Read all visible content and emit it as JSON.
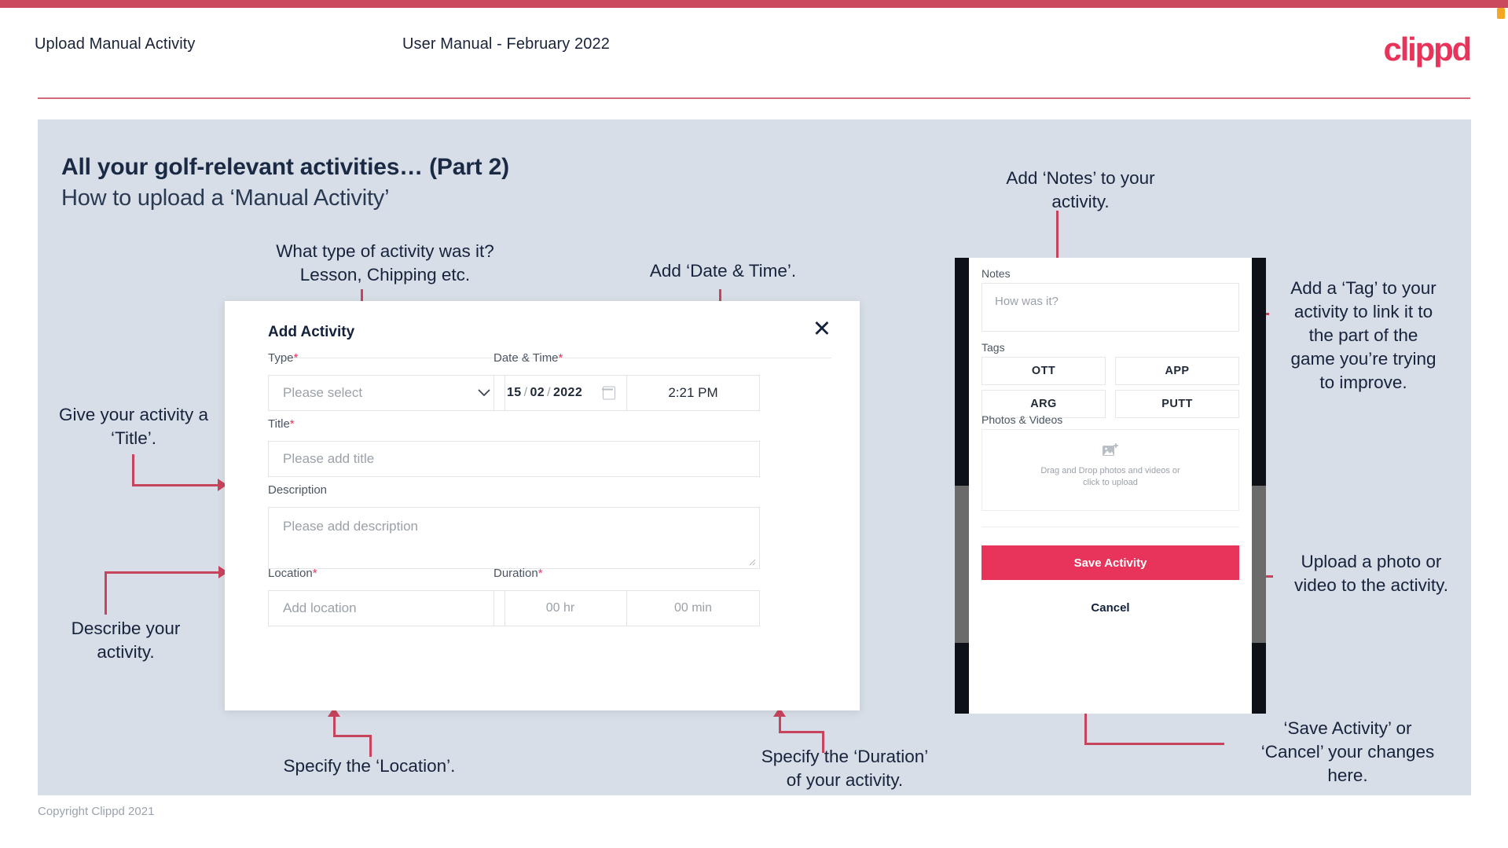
{
  "brand": {
    "accent": "#e8335a",
    "bar": "#cc4a5e",
    "panel_bg": "#d7dee7",
    "logo_text": "clippd"
  },
  "header": {
    "left_title": "Upload Manual Activity",
    "center_title": "User Manual - February 2022"
  },
  "slide": {
    "heading": "All your golf-relevant activities… (Part 2)",
    "subheading": "How to upload a ‘Manual Activity’"
  },
  "footer": {
    "copyright": "Copyright Clippd 2021"
  },
  "dialog": {
    "title": "Add Activity",
    "close_icon": "close-icon",
    "fields": {
      "type": {
        "label": "Type",
        "required": "*",
        "placeholder": "Please select",
        "chevron": "chevron-down-icon"
      },
      "datetime": {
        "label": "Date & Time",
        "required": "*",
        "day": "15",
        "month": "02",
        "year": "2022",
        "sep": "/",
        "calendar_icon": "calendar-icon",
        "time": "2:21 PM"
      },
      "title": {
        "label": "Title",
        "required": "*",
        "placeholder": "Please add title"
      },
      "description": {
        "label": "Description",
        "required": "",
        "placeholder": "Please add description"
      },
      "location": {
        "label": "Location",
        "required": "*",
        "placeholder": "Add location"
      },
      "duration": {
        "label": "Duration",
        "required": "*",
        "hours": "00 hr",
        "minutes": "00 min"
      }
    }
  },
  "phone": {
    "notes": {
      "label": "Notes",
      "placeholder": "How was it?"
    },
    "tags": {
      "label": "Tags",
      "items": [
        "OTT",
        "APP",
        "ARG",
        "PUTT"
      ]
    },
    "photos": {
      "label": "Photos & Videos",
      "icon": "add-image-icon",
      "drop_line1": "Drag and Drop photos and videos or",
      "drop_line2": "click to upload"
    },
    "save_label": "Save Activity",
    "cancel_label": "Cancel"
  },
  "annotations": {
    "type": "What type of activity was it?\nLesson, Chipping etc.",
    "datetime": "Add ‘Date & Time’.",
    "title": "Give your activity a\n‘Title’.",
    "description": "Describe your\nactivity.",
    "location": "Specify the ‘Location’.",
    "duration": "Specify the ‘Duration’\nof your activity.",
    "notes": "Add ‘Notes’ to your\nactivity.",
    "tags": "Add a ‘Tag’ to your\nactivity to link it to\nthe part of the\ngame you’re trying\nto improve.",
    "photos": "Upload a photo or\nvideo to the activity.",
    "save": "‘Save Activity’ or\n‘Cancel’ your changes\nhere."
  }
}
